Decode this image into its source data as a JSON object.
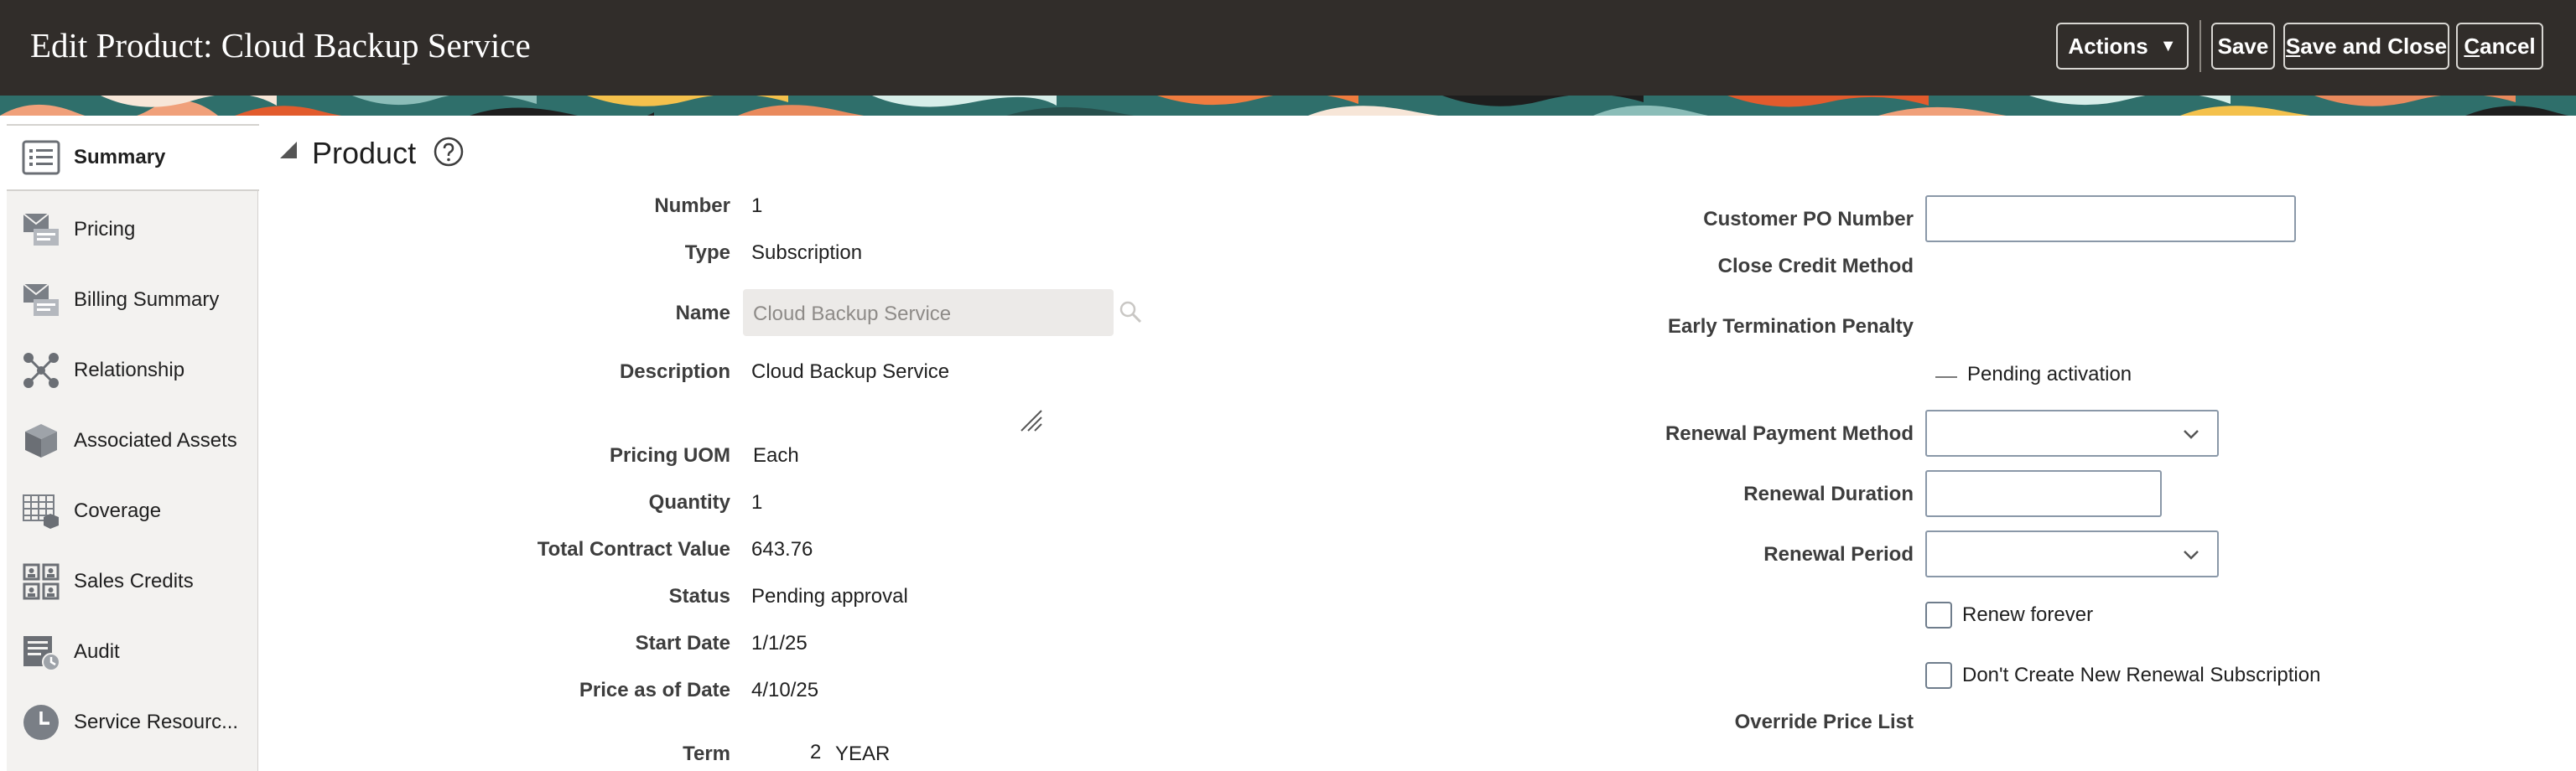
{
  "header": {
    "title": "Edit Product: Cloud Backup Service",
    "actions_label": "Actions",
    "save_label": "Save",
    "save_close_label": "Save and Close",
    "cancel_label": "Cancel"
  },
  "sidebar": {
    "items": [
      {
        "label": "Summary",
        "icon": "list-icon",
        "active": true
      },
      {
        "label": "Pricing",
        "icon": "pricing-icon"
      },
      {
        "label": "Billing Summary",
        "icon": "billing-icon"
      },
      {
        "label": "Relationship",
        "icon": "network-icon"
      },
      {
        "label": "Associated Assets",
        "icon": "cube-icon"
      },
      {
        "label": "Coverage",
        "icon": "grid-icon"
      },
      {
        "label": "Sales Credits",
        "icon": "users-grid-icon"
      },
      {
        "label": "Audit",
        "icon": "audit-icon"
      },
      {
        "label": "Service Resourc...",
        "icon": "clock-icon"
      }
    ]
  },
  "section": {
    "title": "Product"
  },
  "left_fields": {
    "number": {
      "label": "Number",
      "value": "1"
    },
    "type": {
      "label": "Type",
      "value": "Subscription"
    },
    "name": {
      "label": "Name",
      "value": "Cloud Backup Service"
    },
    "description": {
      "label": "Description",
      "value": "Cloud Backup Service"
    },
    "pricing_uom": {
      "label": "Pricing UOM",
      "value": "Each"
    },
    "quantity": {
      "label": "Quantity",
      "value": "1"
    },
    "total_contract_value": {
      "label": "Total Contract Value",
      "value": "643.76"
    },
    "status": {
      "label": "Status",
      "value": "Pending approval"
    },
    "start_date": {
      "label": "Start Date",
      "value": "1/1/25"
    },
    "price_as_of_date": {
      "label": "Price as of Date",
      "value": "4/10/25"
    },
    "term": {
      "label": "Term",
      "value": "2",
      "unit": "YEAR"
    }
  },
  "right_fields": {
    "customer_po": {
      "label": "Customer PO Number",
      "value": ""
    },
    "close_credit_method": {
      "label": "Close Credit Method"
    },
    "early_termination_penalty": {
      "label": "Early Termination Penalty"
    },
    "pending_activation": "Pending activation",
    "renewal_payment_method": {
      "label": "Renewal Payment Method",
      "value": ""
    },
    "renewal_duration": {
      "label": "Renewal Duration",
      "value": ""
    },
    "renewal_period": {
      "label": "Renewal Period",
      "value": ""
    },
    "renew_forever": {
      "label": "Renew forever",
      "checked": false
    },
    "dont_create_renewal": {
      "label": "Don't Create New Renewal Subscription",
      "checked": false
    },
    "override_price_list": {
      "label": "Override Price List"
    }
  },
  "colors": {
    "header_bg": "#312d2a",
    "sidebar_bg": "#f3f2f0",
    "input_border": "#8a98a8"
  }
}
